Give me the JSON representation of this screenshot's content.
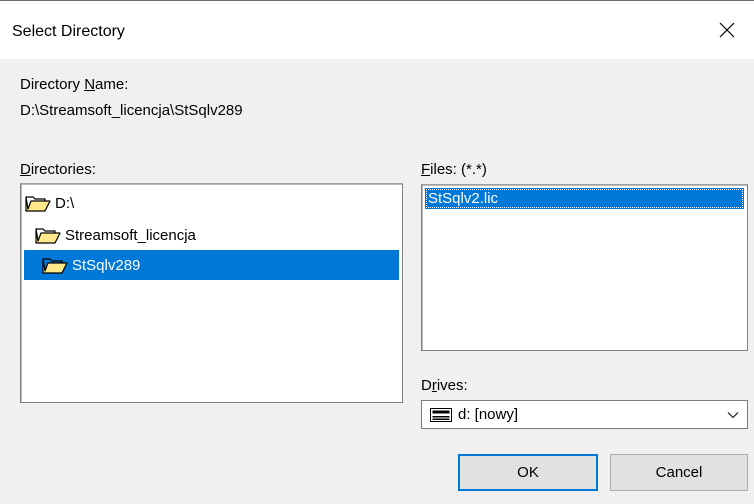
{
  "window": {
    "title": "Select Directory"
  },
  "directory_name": {
    "label_prefix": "Directory ",
    "label_hotkey": "N",
    "label_suffix": "ame:",
    "value": "D:\\Streamsoft_licencja\\StSqlv289"
  },
  "directories": {
    "label_hotkey": "D",
    "label_suffix": "irectories:",
    "items": [
      {
        "label": "D:\\",
        "icon": "open-folder-icon",
        "selected": false
      },
      {
        "label": "Streamsoft_licencja",
        "icon": "open-folder-icon",
        "selected": false
      },
      {
        "label": "StSqlv289",
        "icon": "open-folder-icon",
        "selected": true
      }
    ]
  },
  "files": {
    "label_hotkey": "F",
    "label_suffix": "iles: (*.*)",
    "items": [
      {
        "label": "StSqlv2.lic",
        "selected": true
      }
    ]
  },
  "drives": {
    "label_prefix": "D",
    "label_hotkey": "r",
    "label_suffix": "ives:",
    "selected": "d: [nowy]",
    "icon": "drive-icon"
  },
  "buttons": {
    "ok": "OK",
    "cancel": "Cancel"
  },
  "colors": {
    "selection": "#0078d7",
    "folder_fill": "#ffe98a",
    "dialog_bg": "#f0f0f0"
  }
}
